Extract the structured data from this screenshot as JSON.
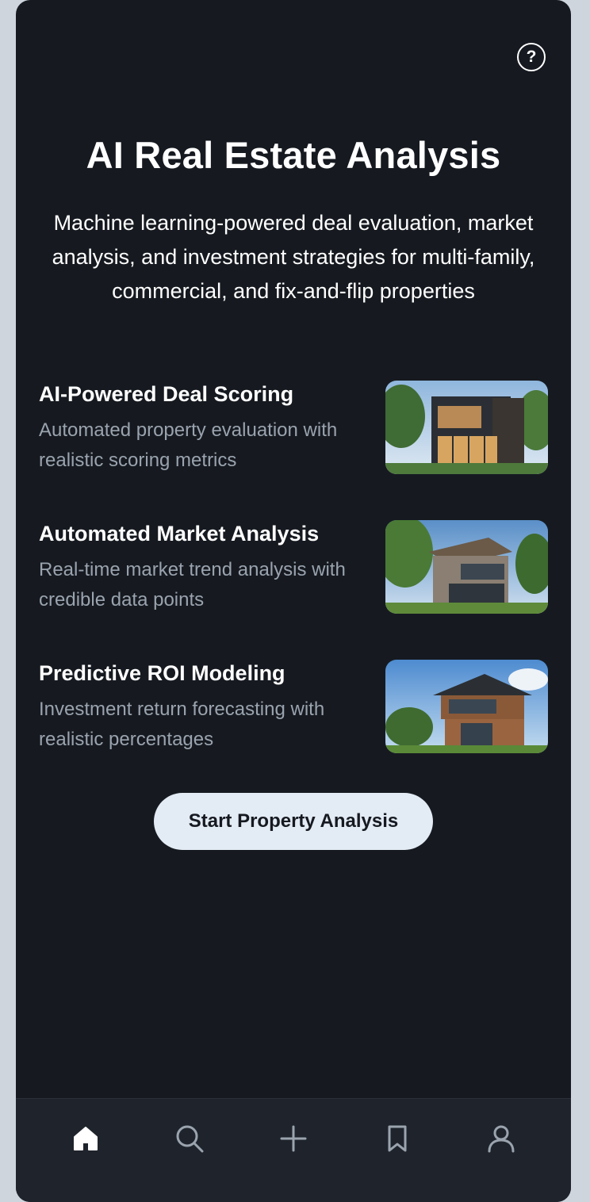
{
  "header": {
    "help_icon": "help-circle-icon",
    "help_glyph": "?"
  },
  "hero": {
    "title": "AI Real Estate Analysis",
    "subtitle": "Machine learning-powered deal evaluation, market analysis, and investment strategies for multi-family, commercial, and fix-and-flip properties"
  },
  "features": [
    {
      "title": "AI-Powered Deal Scoring",
      "description": "Automated property evaluation with realistic scoring metrics"
    },
    {
      "title": "Automated Market Analysis",
      "description": "Real-time market trend analysis with credible data points"
    },
    {
      "title": "Predictive ROI Modeling",
      "description": "Investment return forecasting with realistic percentages"
    }
  ],
  "cta": {
    "label": "Start Property Analysis"
  },
  "bottom_nav": {
    "items": [
      {
        "icon": "home-icon",
        "active": true
      },
      {
        "icon": "search-icon",
        "active": false
      },
      {
        "icon": "plus-icon",
        "active": false
      },
      {
        "icon": "bookmark-icon",
        "active": false
      },
      {
        "icon": "user-icon",
        "active": false
      }
    ]
  },
  "colors": {
    "background": "#161a20",
    "nav_background": "#1f242c",
    "cta_background": "#e3ebf4",
    "muted_text": "#9aa3ae",
    "active_icon": "#ffffff",
    "inactive_icon": "#9aa3ae"
  }
}
